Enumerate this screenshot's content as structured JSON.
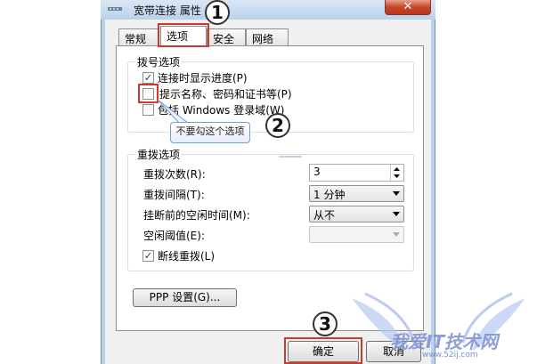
{
  "window": {
    "title": "宽带连接 属性",
    "close": "✕"
  },
  "tabs": [
    {
      "label": "常规"
    },
    {
      "label": "选项"
    },
    {
      "label": "安全"
    },
    {
      "label": "网络"
    }
  ],
  "dial_options": {
    "title": "拨号选项",
    "items": [
      {
        "label": "连接时显示进度(P)",
        "checked": true
      },
      {
        "label": "提示名称、密码和证书等(P)",
        "checked": false
      },
      {
        "label": "包括 Windows 登录域(W)",
        "checked": false
      }
    ]
  },
  "tooltip": {
    "text": "不要勾这个选项"
  },
  "redial_options": {
    "title": "重拨选项",
    "redial_count_label": "重拨次数(R):",
    "redial_count_value": "3",
    "redial_interval_label": "重拨间隔(T):",
    "redial_interval_value": "1 分钟",
    "idle_before_hangup_label": "挂断前的空闲时间(M):",
    "idle_before_hangup_value": "从不",
    "idle_threshold_label": "空闲阈值(E):",
    "idle_threshold_value": "",
    "reconnect_label": "断线重拨(L)",
    "reconnect_checked": true
  },
  "ppp_button": "PPP 设置(G)...",
  "ok_button": "确定",
  "cancel_button": "取消",
  "annotations": [
    "1",
    "2",
    "3"
  ],
  "watermark": {
    "text": "我爱IT技术网",
    "url": "www.52ij.com"
  },
  "colors": {
    "annotation_red": "#cc3a2e",
    "window_frame": "#b9d1ea",
    "tooltip_border": "#6fa0cf"
  }
}
